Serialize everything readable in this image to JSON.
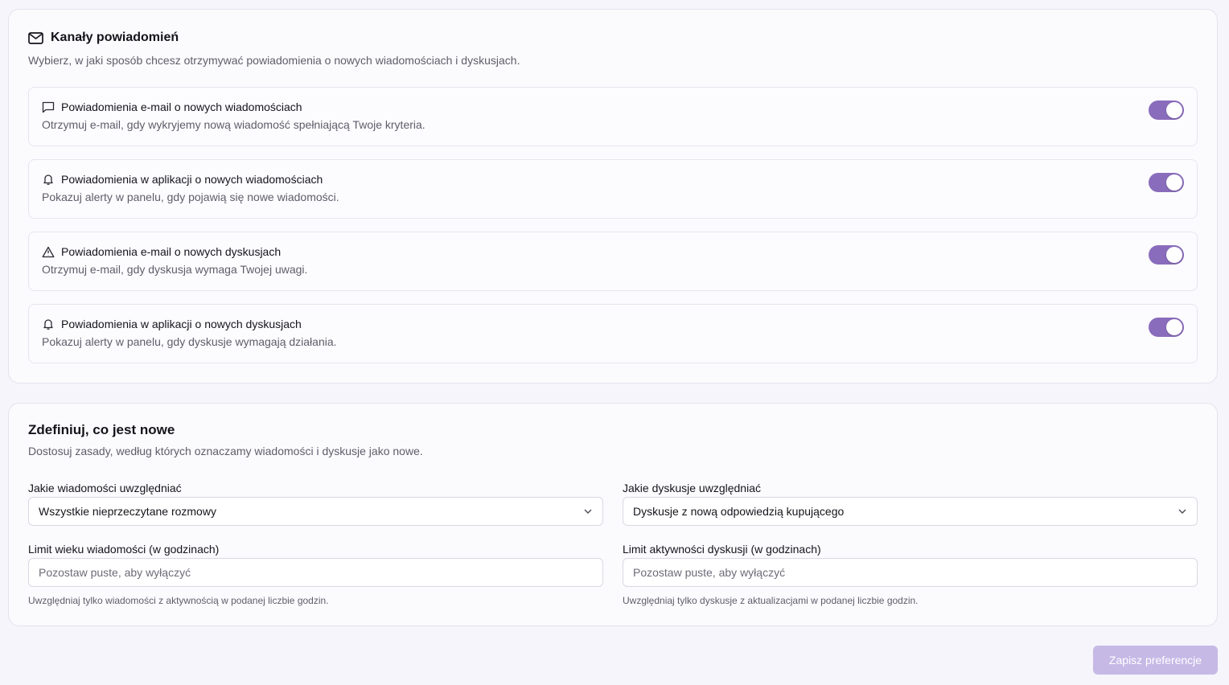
{
  "channels": {
    "title": "Kanały powiadomień",
    "subtitle": "Wybierz, w jaki sposób chcesz otrzymywać powiadomienia o nowych wiadomościach i dyskusjach.",
    "icon": "mail-icon",
    "items": [
      {
        "icon": "message-icon",
        "title": "Powiadomienia e-mail o nowych wiadomościach",
        "description": "Otrzymuj e-mail, gdy wykryjemy nową wiadomość spełniającą Twoje kryteria.",
        "enabled": true
      },
      {
        "icon": "bell-icon",
        "title": "Powiadomienia w aplikacji o nowych wiadomościach",
        "description": "Pokazuj alerty w panelu, gdy pojawią się nowe wiadomości.",
        "enabled": true
      },
      {
        "icon": "warning-icon",
        "title": "Powiadomienia e-mail o nowych dyskusjach",
        "description": "Otrzymuj e-mail, gdy dyskusja wymaga Twojej uwagi.",
        "enabled": true
      },
      {
        "icon": "bell-icon",
        "title": "Powiadomienia w aplikacji o nowych dyskusjach",
        "description": "Pokazuj alerty w panelu, gdy dyskusje wymagają działania.",
        "enabled": true
      }
    ]
  },
  "define": {
    "title": "Zdefiniuj, co jest nowe",
    "subtitle": "Dostosuj zasady, według których oznaczamy wiadomości i dyskusje jako nowe.",
    "messages_label": "Jakie wiadomości uwzględniać",
    "messages_value": "Wszystkie nieprzeczytane rozmowy",
    "discussions_label": "Jakie dyskusje uwzględniać",
    "discussions_value": "Dyskusje z nową odpowiedzią kupującego",
    "msg_age_label": "Limit wieku wiadomości (w godzinach)",
    "msg_age_placeholder": "Pozostaw puste, aby wyłączyć",
    "msg_age_help": "Uwzględniaj tylko wiadomości z aktywnością w podanej liczbie godzin.",
    "disc_age_label": "Limit aktywności dyskusji (w godzinach)",
    "disc_age_placeholder": "Pozostaw puste, aby wyłączyć",
    "disc_age_help": "Uwzględniaj tylko dyskusje z aktualizacjami w podanej liczbie godzin."
  },
  "save_label": "Zapisz preferencje",
  "colors": {
    "accent": "#8a6cbc",
    "accent_disabled": "#c6b9e6"
  }
}
